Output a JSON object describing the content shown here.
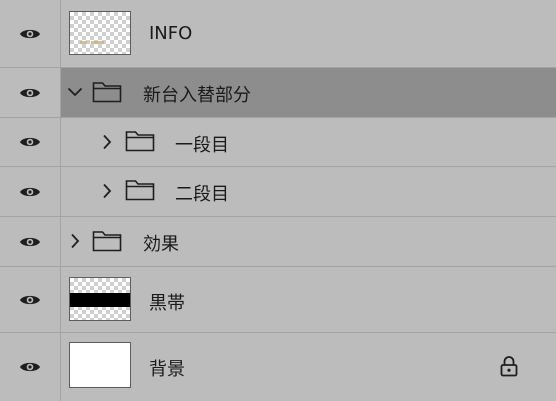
{
  "layers": [
    {
      "name": "INFO",
      "kind": "text-thumb"
    },
    {
      "name": "新台入替部分",
      "kind": "group",
      "expanded": true,
      "selected": true
    },
    {
      "name": "一段目",
      "kind": "group",
      "expanded": false,
      "nested": true
    },
    {
      "name": "二段目",
      "kind": "group",
      "expanded": false,
      "nested": true
    },
    {
      "name": "効果",
      "kind": "group",
      "expanded": false
    },
    {
      "name": "黒帯",
      "kind": "band-thumb"
    },
    {
      "name": "背景",
      "kind": "solid-thumb",
      "locked": true
    }
  ],
  "icons": {
    "visibility": "eye-icon",
    "group": "folder-icon",
    "expanded": "chevron-down-icon",
    "collapsed": "chevron-right-icon",
    "locked": "lock-icon"
  },
  "colors": {
    "panel_bg": "#bcbcbc",
    "selected_bg": "#8d8d8d",
    "divider": "#a3a3a3"
  }
}
